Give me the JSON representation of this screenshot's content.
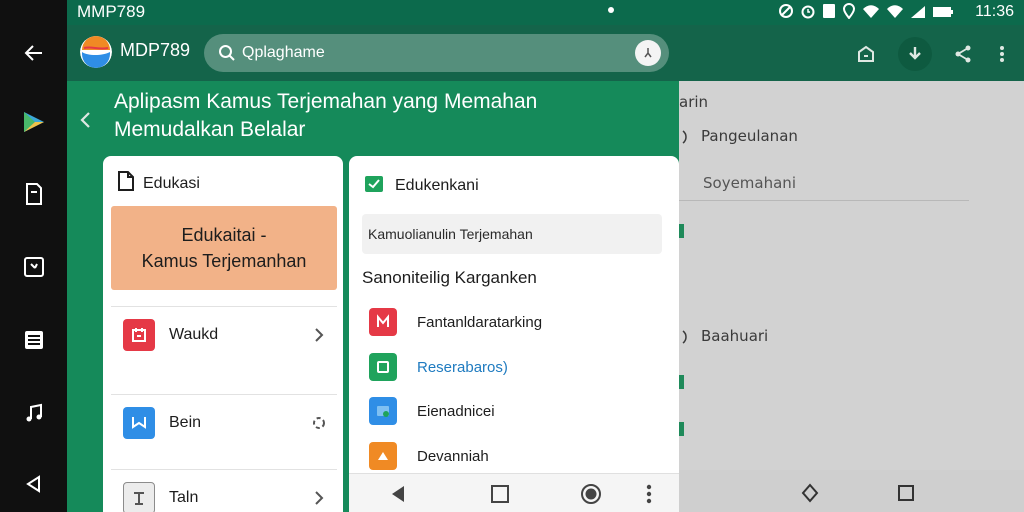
{
  "status_bar": {
    "title": "MMP789",
    "time": "11:36"
  },
  "app_bar": {
    "app_name": "MDP789",
    "search_text": "Qplaghame"
  },
  "headline": {
    "line1": "Aplipasm Kamus Terjemahan yang Memahan",
    "line2": "Memudalkan Belalar"
  },
  "left_card": {
    "title": "Edukasi",
    "feature_line1": "Edukaitai -",
    "feature_line2": "Kamus Terjemanhan",
    "rows": [
      {
        "label": "Waukd",
        "color": "#e53946"
      },
      {
        "label": "Bein",
        "color": "#2f8ee6"
      },
      {
        "label": "Taln",
        "color": "#8c8c8c"
      }
    ]
  },
  "right_card": {
    "title": "Edukenkani",
    "field_text": "Kamuolianulin Terjemahan",
    "section_title": "Sanoniteilig Karganken",
    "items": [
      {
        "label": "Fantanldaratarking",
        "color": "#e53946"
      },
      {
        "label": "Reserabaros)",
        "color": "#1fa35c",
        "accent": "#1f7bc0"
      },
      {
        "label": "Eienadnicei",
        "color": "#2f8ee6"
      },
      {
        "label": "Devanniah",
        "color": "#f08a24"
      }
    ]
  },
  "background_app": {
    "texts": [
      "arin",
      "Pangeulanan",
      "Soyemahani",
      "Baahuari"
    ]
  },
  "colors": {
    "primary_green": "#158a5a",
    "dark_green": "#14644a",
    "status_green": "#0c6a4c",
    "feature_orange": "#f2b288"
  }
}
